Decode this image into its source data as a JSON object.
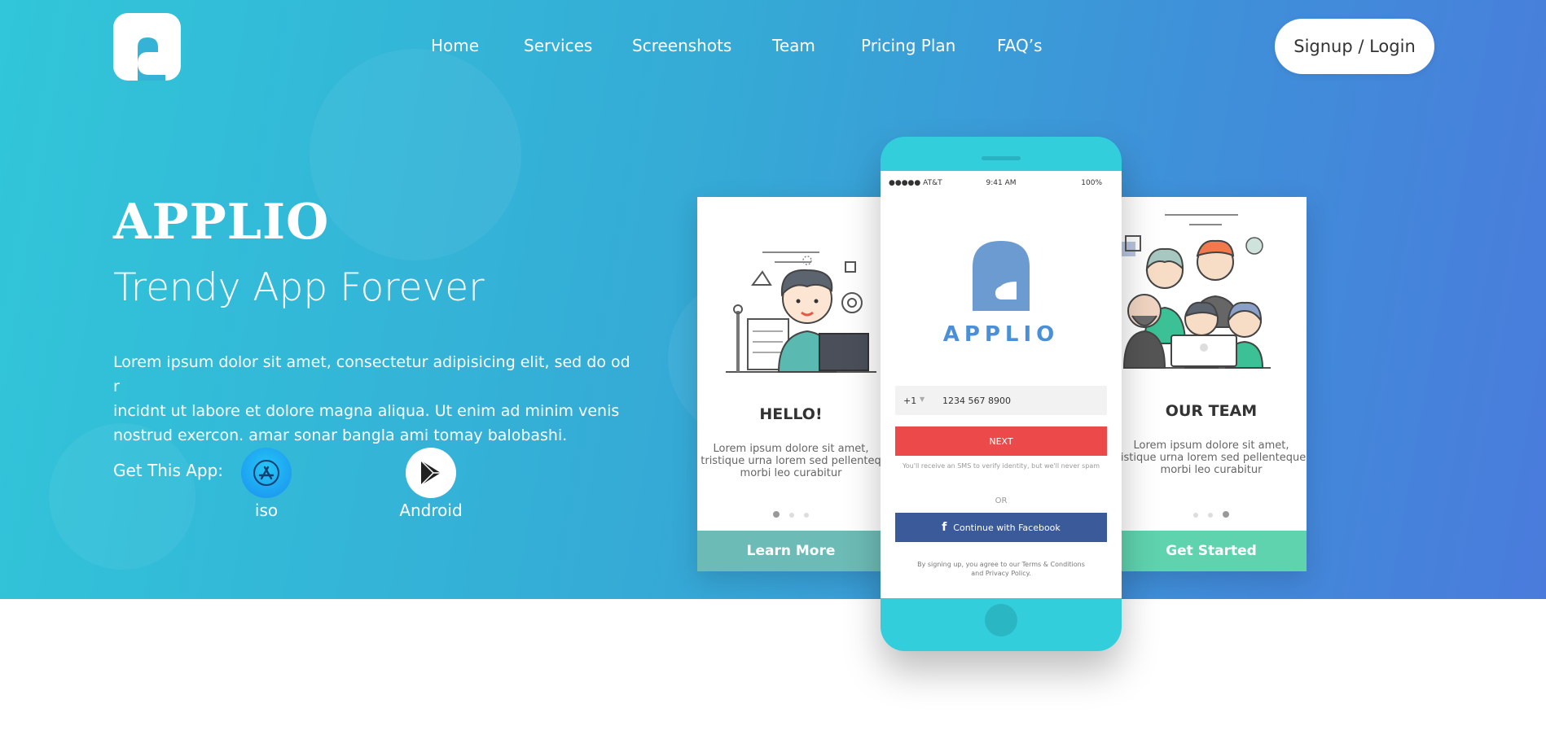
{
  "nav": {
    "items": [
      {
        "label": "Home"
      },
      {
        "label": "Services"
      },
      {
        "label": "Screenshots"
      },
      {
        "label": "Team"
      },
      {
        "label": "Pricing Plan"
      },
      {
        "label": "FAQ’s"
      }
    ],
    "signup_label": "Signup / Login"
  },
  "hero": {
    "brand": "APPLIO",
    "tagline": "Trendy App Forever",
    "description_lines": [
      "Lorem ipsum dolor sit amet, consectetur adipisicing elit, sed do od r",
      "incidnt ut labore et dolore magna aliqua. Ut enim ad minim venis",
      "nostrud exercon. amar sonar bangla ami tomay balobashi."
    ],
    "get_app_label": "Get This App:",
    "stores": [
      {
        "label": "iso",
        "icon": "app-store-icon"
      },
      {
        "label": "Android",
        "icon": "google-play-icon"
      }
    ]
  },
  "mockup": {
    "left_card": {
      "title": "HELLO!",
      "text_lines": [
        "Lorem ipsum dolore sit amet,",
        "tristique urna lorem sed pellenteq",
        "morbi leo curabitur"
      ],
      "button": "Learn More",
      "button_color": "#6dbbb6"
    },
    "right_card": {
      "title": "OUR TEAM",
      "text_lines": [
        "Lorem ipsum dolore sit amet,",
        "tistique urna lorem sed pellenteque",
        "morbi leo curabitur"
      ],
      "button": "Get Started",
      "button_color": "#5fd3ae"
    },
    "phone": {
      "status_carrier": "●●●●● AT&T",
      "status_time": "9:41 AM",
      "status_battery": "100%",
      "app_name": "APPLIO",
      "country_code": "+1",
      "phone_number": "1234 567 8900",
      "next_label": "NEXT",
      "sms_note": "You'll receive an SMS to verify identity, but we'll never spam",
      "or_label": "OR",
      "facebook_label": "Continue with Facebook",
      "terms_line1": "By signing up, you agree to our Terms & Conditions",
      "terms_line2": "and Privacy Policy."
    }
  },
  "colors": {
    "hero_start": "#31c6d9",
    "hero_end": "#4a7bdc",
    "next_button": "#ec4a4a",
    "facebook_button": "#3b5a9a",
    "phone_body": "#33cedc"
  }
}
